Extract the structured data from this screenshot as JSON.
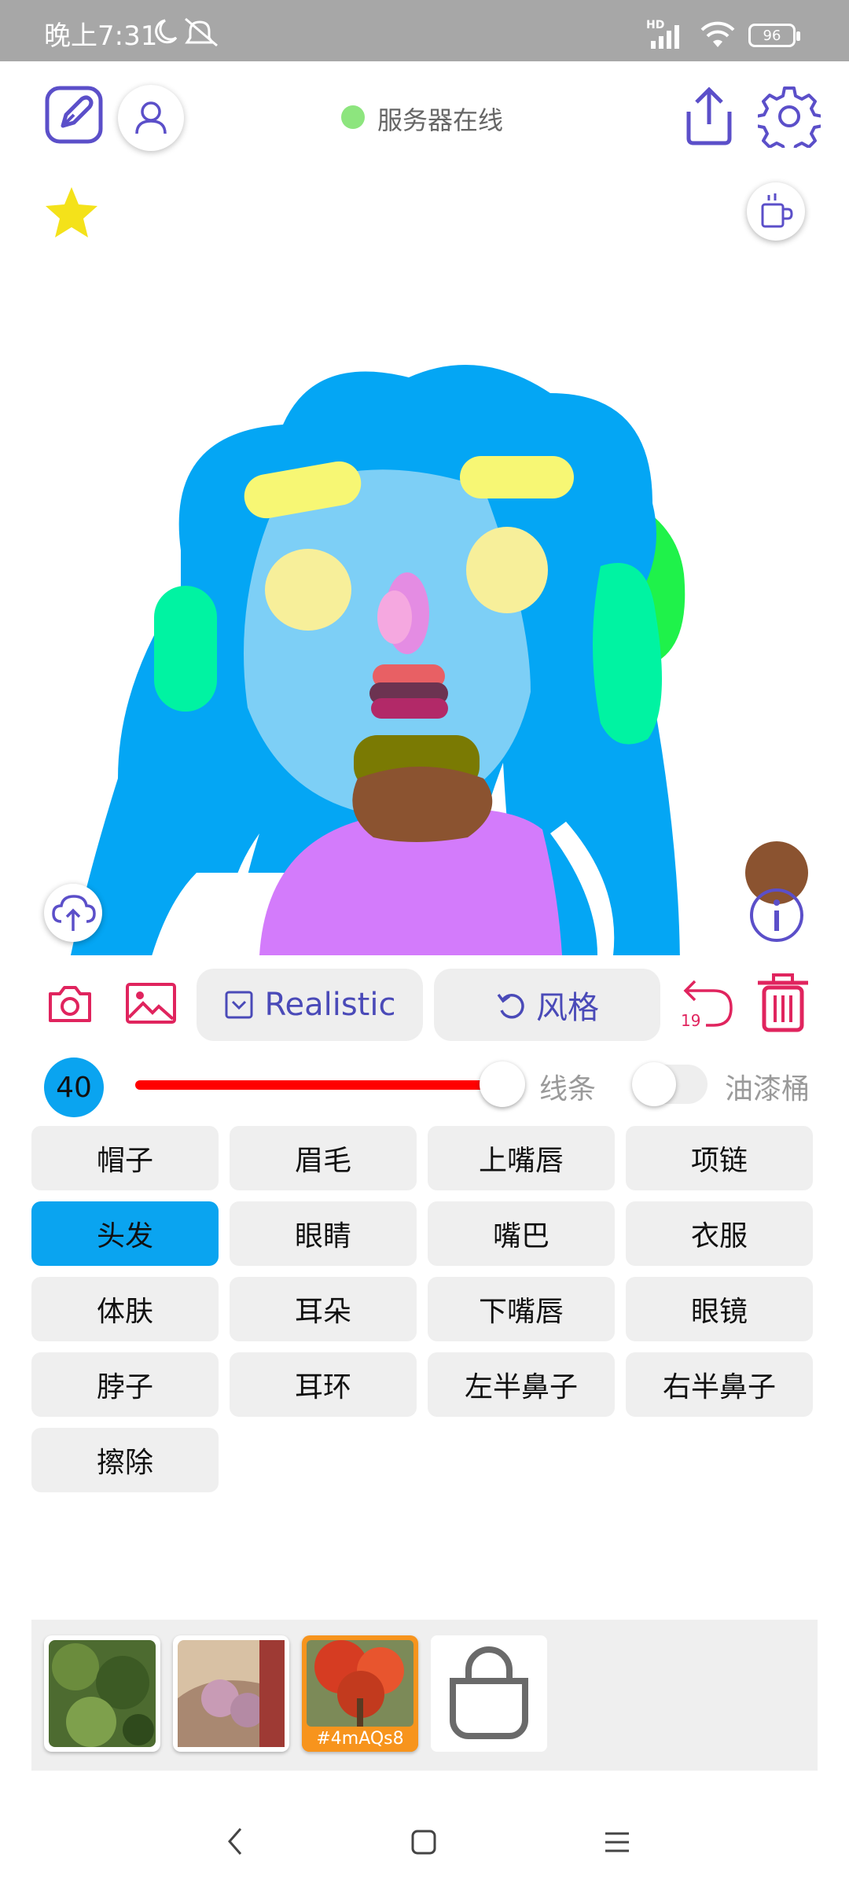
{
  "status_bar": {
    "time": "晚上7:31",
    "battery": "96",
    "network": "HD"
  },
  "header": {
    "server_status": "服务器在线",
    "icons": [
      "edit-icon",
      "user-icon",
      "share-icon",
      "settings-icon"
    ]
  },
  "toolbar": {
    "model_label": "Realistic",
    "style_label": "风格",
    "undo_count": "19"
  },
  "brush": {
    "size": "40",
    "stroke_label": "线条",
    "bucket_label": "油漆桶",
    "bucket_enabled": false,
    "accent_color": "#ff0000"
  },
  "parts": [
    {
      "label": "帽子",
      "active": false
    },
    {
      "label": "眉毛",
      "active": false
    },
    {
      "label": "上嘴唇",
      "active": false
    },
    {
      "label": "项链",
      "active": false
    },
    {
      "label": "头发",
      "active": true
    },
    {
      "label": "眼睛",
      "active": false
    },
    {
      "label": "嘴巴",
      "active": false
    },
    {
      "label": "衣服",
      "active": false
    },
    {
      "label": "体肤",
      "active": false
    },
    {
      "label": "耳朵",
      "active": false
    },
    {
      "label": "下嘴唇",
      "active": false
    },
    {
      "label": "眼镜",
      "active": false
    },
    {
      "label": "脖子",
      "active": false
    },
    {
      "label": "耳环",
      "active": false
    },
    {
      "label": "左半鼻子",
      "active": false
    },
    {
      "label": "右半鼻子",
      "active": false
    },
    {
      "label": "擦除",
      "active": false
    }
  ],
  "thumbnails": [
    {
      "tag": ""
    },
    {
      "tag": ""
    },
    {
      "tag": "#4mAQs8"
    }
  ],
  "colors": {
    "accent_blue": "#0aa4f0",
    "brand_purple": "#5b4fc9",
    "danger_red": "#e0245e"
  }
}
